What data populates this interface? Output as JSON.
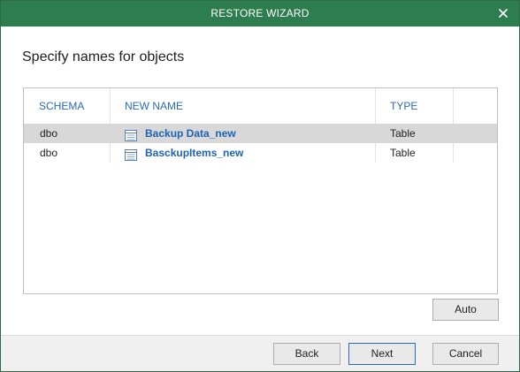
{
  "window": {
    "title": "RESTORE WIZARD",
    "accent_color": "#2d7d4f",
    "close_icon": "close-icon"
  },
  "header": {
    "heading": "Specify names for objects"
  },
  "table": {
    "columns": [
      "SCHEMA",
      "NEW NAME",
      "TYPE"
    ],
    "rows": [
      {
        "schema": "dbo",
        "new_name": "Backup Data_new",
        "type": "Table",
        "icon": "table-icon",
        "selected": true
      },
      {
        "schema": "dbo",
        "new_name": "BasckupItems_new",
        "type": "Table",
        "icon": "table-icon",
        "selected": false
      }
    ],
    "header_color": "#2a6bb5",
    "link_color": "#1c63b7"
  },
  "buttons": {
    "auto": "Auto",
    "back": "Back",
    "next": "Next",
    "cancel": "Cancel"
  }
}
